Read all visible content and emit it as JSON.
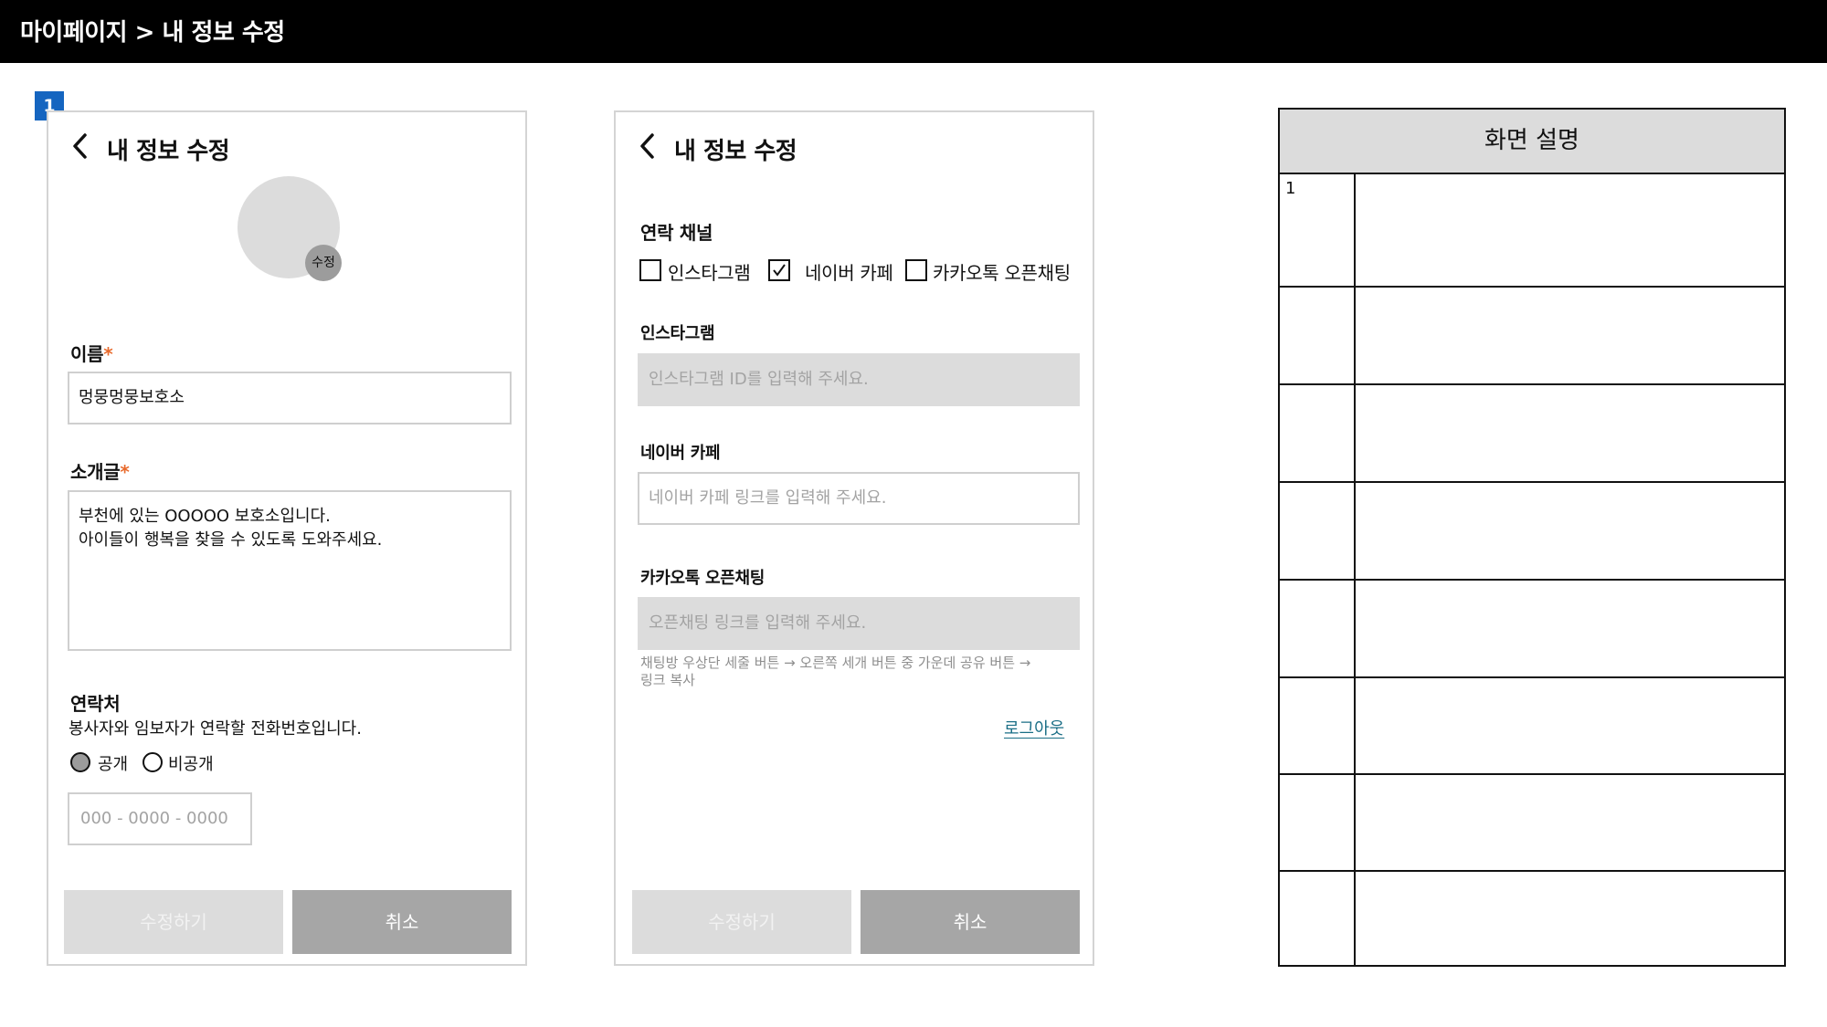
{
  "header": {
    "breadcrumb": "마이페이지 > 내 정보 수정"
  },
  "marker": "1",
  "screen1": {
    "title": "내 정보 수정",
    "avatar_edit": "수정",
    "name_label": "이름",
    "required_mark": "*",
    "name_value": "멍뭉멍뭉보호소",
    "intro_label": "소개글",
    "intro_value": "부천에 있는 OOOOO 보호소입니다.\n아이들이 행복을 찾을 수 있도록 도와주세요.",
    "contact_label": "연락처",
    "contact_desc": "봉사자와 임보자가 연락할 전화번호입니다.",
    "radio_public": "공개",
    "radio_private": "비공개",
    "radio_selected": "공개",
    "phone_placeholder": "000 - 0000 - 0000",
    "submit": "수정하기",
    "cancel": "취소"
  },
  "screen2": {
    "title": "내 정보 수정",
    "channel_label": "연락 채널",
    "channels": [
      {
        "label": "인스타그램",
        "checked": false
      },
      {
        "label": "네이버 카페",
        "checked": true
      },
      {
        "label": "카카오톡 오픈채팅",
        "checked": false
      }
    ],
    "instagram_label": "인스타그램",
    "instagram_placeholder": "인스타그램 ID를 입력해 주세요.",
    "naver_label": "네이버 카페",
    "naver_placeholder": "네이버 카페 링크를 입력해 주세요.",
    "kakao_label": "카카오톡 오픈채팅",
    "kakao_placeholder": "오픈채팅 링크를 입력해 주세요.",
    "kakao_hint": "채팅방 우상단 세줄 버튼 → 오른쪽 세개 버튼 중 가운데 공유 버튼 →\n링크 복사",
    "logout": "로그아웃",
    "submit": "수정하기",
    "cancel": "취소"
  },
  "description_table": {
    "title": "화면 설명",
    "rows": [
      {
        "num": "1",
        "text": ""
      },
      {
        "num": "",
        "text": ""
      },
      {
        "num": "",
        "text": ""
      },
      {
        "num": "",
        "text": ""
      },
      {
        "num": "",
        "text": ""
      },
      {
        "num": "",
        "text": ""
      },
      {
        "num": "",
        "text": ""
      },
      {
        "num": "",
        "text": ""
      }
    ]
  }
}
